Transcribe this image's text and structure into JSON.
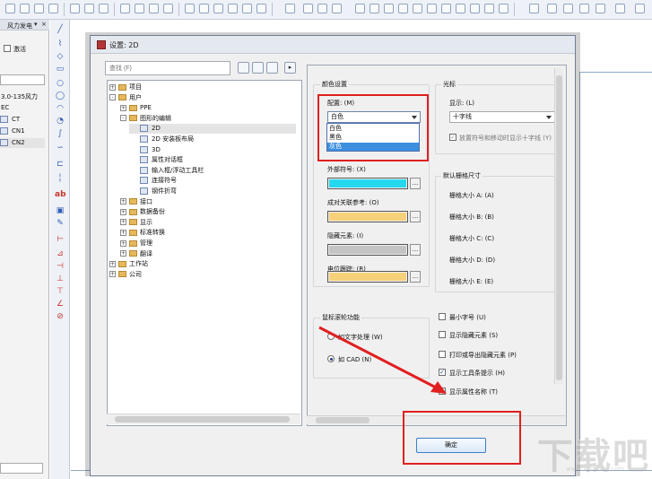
{
  "left_panel": {
    "title": "风力发电",
    "activate_label": "激活",
    "project_label": "3.0-135风力",
    "project_suffix": "EC",
    "items": [
      "CT",
      "CN1",
      "CN2"
    ]
  },
  "dialog": {
    "title": "设置: 2D",
    "search_placeholder": "查找 (F)",
    "tree": [
      {
        "label": "项目",
        "expander": "+",
        "level": 0,
        "type": "folder"
      },
      {
        "label": "用户",
        "expander": "-",
        "level": 0,
        "type": "folder"
      },
      {
        "label": "PPE",
        "expander": "+",
        "level": 1,
        "type": "folder"
      },
      {
        "label": "图形的编辑",
        "expander": "-",
        "level": 1,
        "type": "folder"
      },
      {
        "label": "2D",
        "expander": "",
        "level": 2,
        "type": "page",
        "selected": true
      },
      {
        "label": "2D 安装板布局",
        "expander": "",
        "level": 2,
        "type": "page"
      },
      {
        "label": "3D",
        "expander": "",
        "level": 2,
        "type": "page"
      },
      {
        "label": "属性对话框",
        "expander": "",
        "level": 2,
        "type": "page"
      },
      {
        "label": "输入框/浮动工具栏",
        "expander": "",
        "level": 2,
        "type": "page"
      },
      {
        "label": "连接符号",
        "expander": "",
        "level": 2,
        "type": "page"
      },
      {
        "label": "钢件折弯",
        "expander": "",
        "level": 2,
        "type": "page"
      },
      {
        "label": "接口",
        "expander": "+",
        "level": 1,
        "type": "folder"
      },
      {
        "label": "数据备份",
        "expander": "+",
        "level": 1,
        "type": "folder"
      },
      {
        "label": "显示",
        "expander": "+",
        "level": 1,
        "type": "folder"
      },
      {
        "label": "标准转换",
        "expander": "+",
        "level": 1,
        "type": "folder"
      },
      {
        "label": "管理",
        "expander": "+",
        "level": 1,
        "type": "folder"
      },
      {
        "label": "翻译",
        "expander": "+",
        "level": 1,
        "type": "folder"
      },
      {
        "label": "工作站",
        "expander": "+",
        "level": 0,
        "type": "folder"
      },
      {
        "label": "公司",
        "expander": "+",
        "level": 0,
        "type": "folder"
      }
    ],
    "color_settings": {
      "title": "颜色设置",
      "scheme_label": "配置: (M)",
      "scheme_value": "白色",
      "options": [
        "白色",
        "黑色",
        "灰色"
      ],
      "highlighted_option": "灰色",
      "outer_symbol_label": "外部符号: (X)",
      "outer_symbol_color": "#24d8ee",
      "cross_ref_label": "成对关联参考: (O)",
      "cross_ref_color": "#f7d07a",
      "hidden_label": "隐藏元素: (I)",
      "hidden_color": "#c4c4c4",
      "potential_label": "电位跟踪: (R)",
      "potential_color": "#f7d07a"
    },
    "cursor": {
      "title": "光标",
      "display_label": "显示: (L)",
      "display_value": "十字线",
      "snap_label": "放置符号和移动时显示十字线 (Y)"
    },
    "grid_size": {
      "title": "默认栅格尺寸",
      "items": [
        "栅格大小 A: (A)",
        "栅格大小 B: (B)",
        "栅格大小 C: (C)",
        "栅格大小 D: (D)",
        "栅格大小 E: (E)"
      ]
    },
    "mouse_wheel": {
      "title": "鼠标滚轮功能",
      "option1": "如文字处理 (W)",
      "option2": "如 CAD (N)"
    },
    "checks": [
      {
        "label": "最小字号 (U)",
        "checked": false
      },
      {
        "label": "显示隐藏元素 (S)",
        "checked": false
      },
      {
        "label": "打印或导出隐藏元素 (P)",
        "checked": false
      },
      {
        "label": "显示工具条提示 (H)",
        "checked": true
      },
      {
        "label": "显示属性名称 (T)",
        "checked": false
      }
    ],
    "ok_label": "确定",
    "ellipsis": "..."
  },
  "watermark": {
    "text": "下载吧",
    "url": "www.xiazaiba.com"
  },
  "colors": {
    "annotation_red": "#e11f1f",
    "selection_blue": "#3c8fdf"
  }
}
